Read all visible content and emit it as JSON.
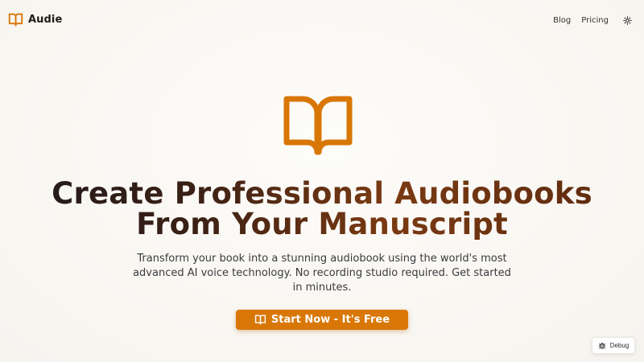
{
  "header": {
    "brand_name": "Audie",
    "brand_icon": "book-open-icon",
    "nav": [
      {
        "label": "Blog"
      },
      {
        "label": "Pricing"
      }
    ],
    "theme_toggle_icon": "sun-icon"
  },
  "hero": {
    "logo_icon": "book-open-icon",
    "title_line1": "Create Professional Audiobooks",
    "title_line2": "From Your Manuscript",
    "subtitle": "Transform your book into a stunning audiobook using the world's most advanced AI voice technology. No recording studio required. Get started in minutes.",
    "cta_label": "Start Now - It's Free",
    "cta_icon": "book-open-icon"
  },
  "debug": {
    "label": "Debug",
    "icon": "bug-icon"
  },
  "colors": {
    "accent": "#d97706",
    "background": "#f8f6f1",
    "text": "#221a17"
  }
}
